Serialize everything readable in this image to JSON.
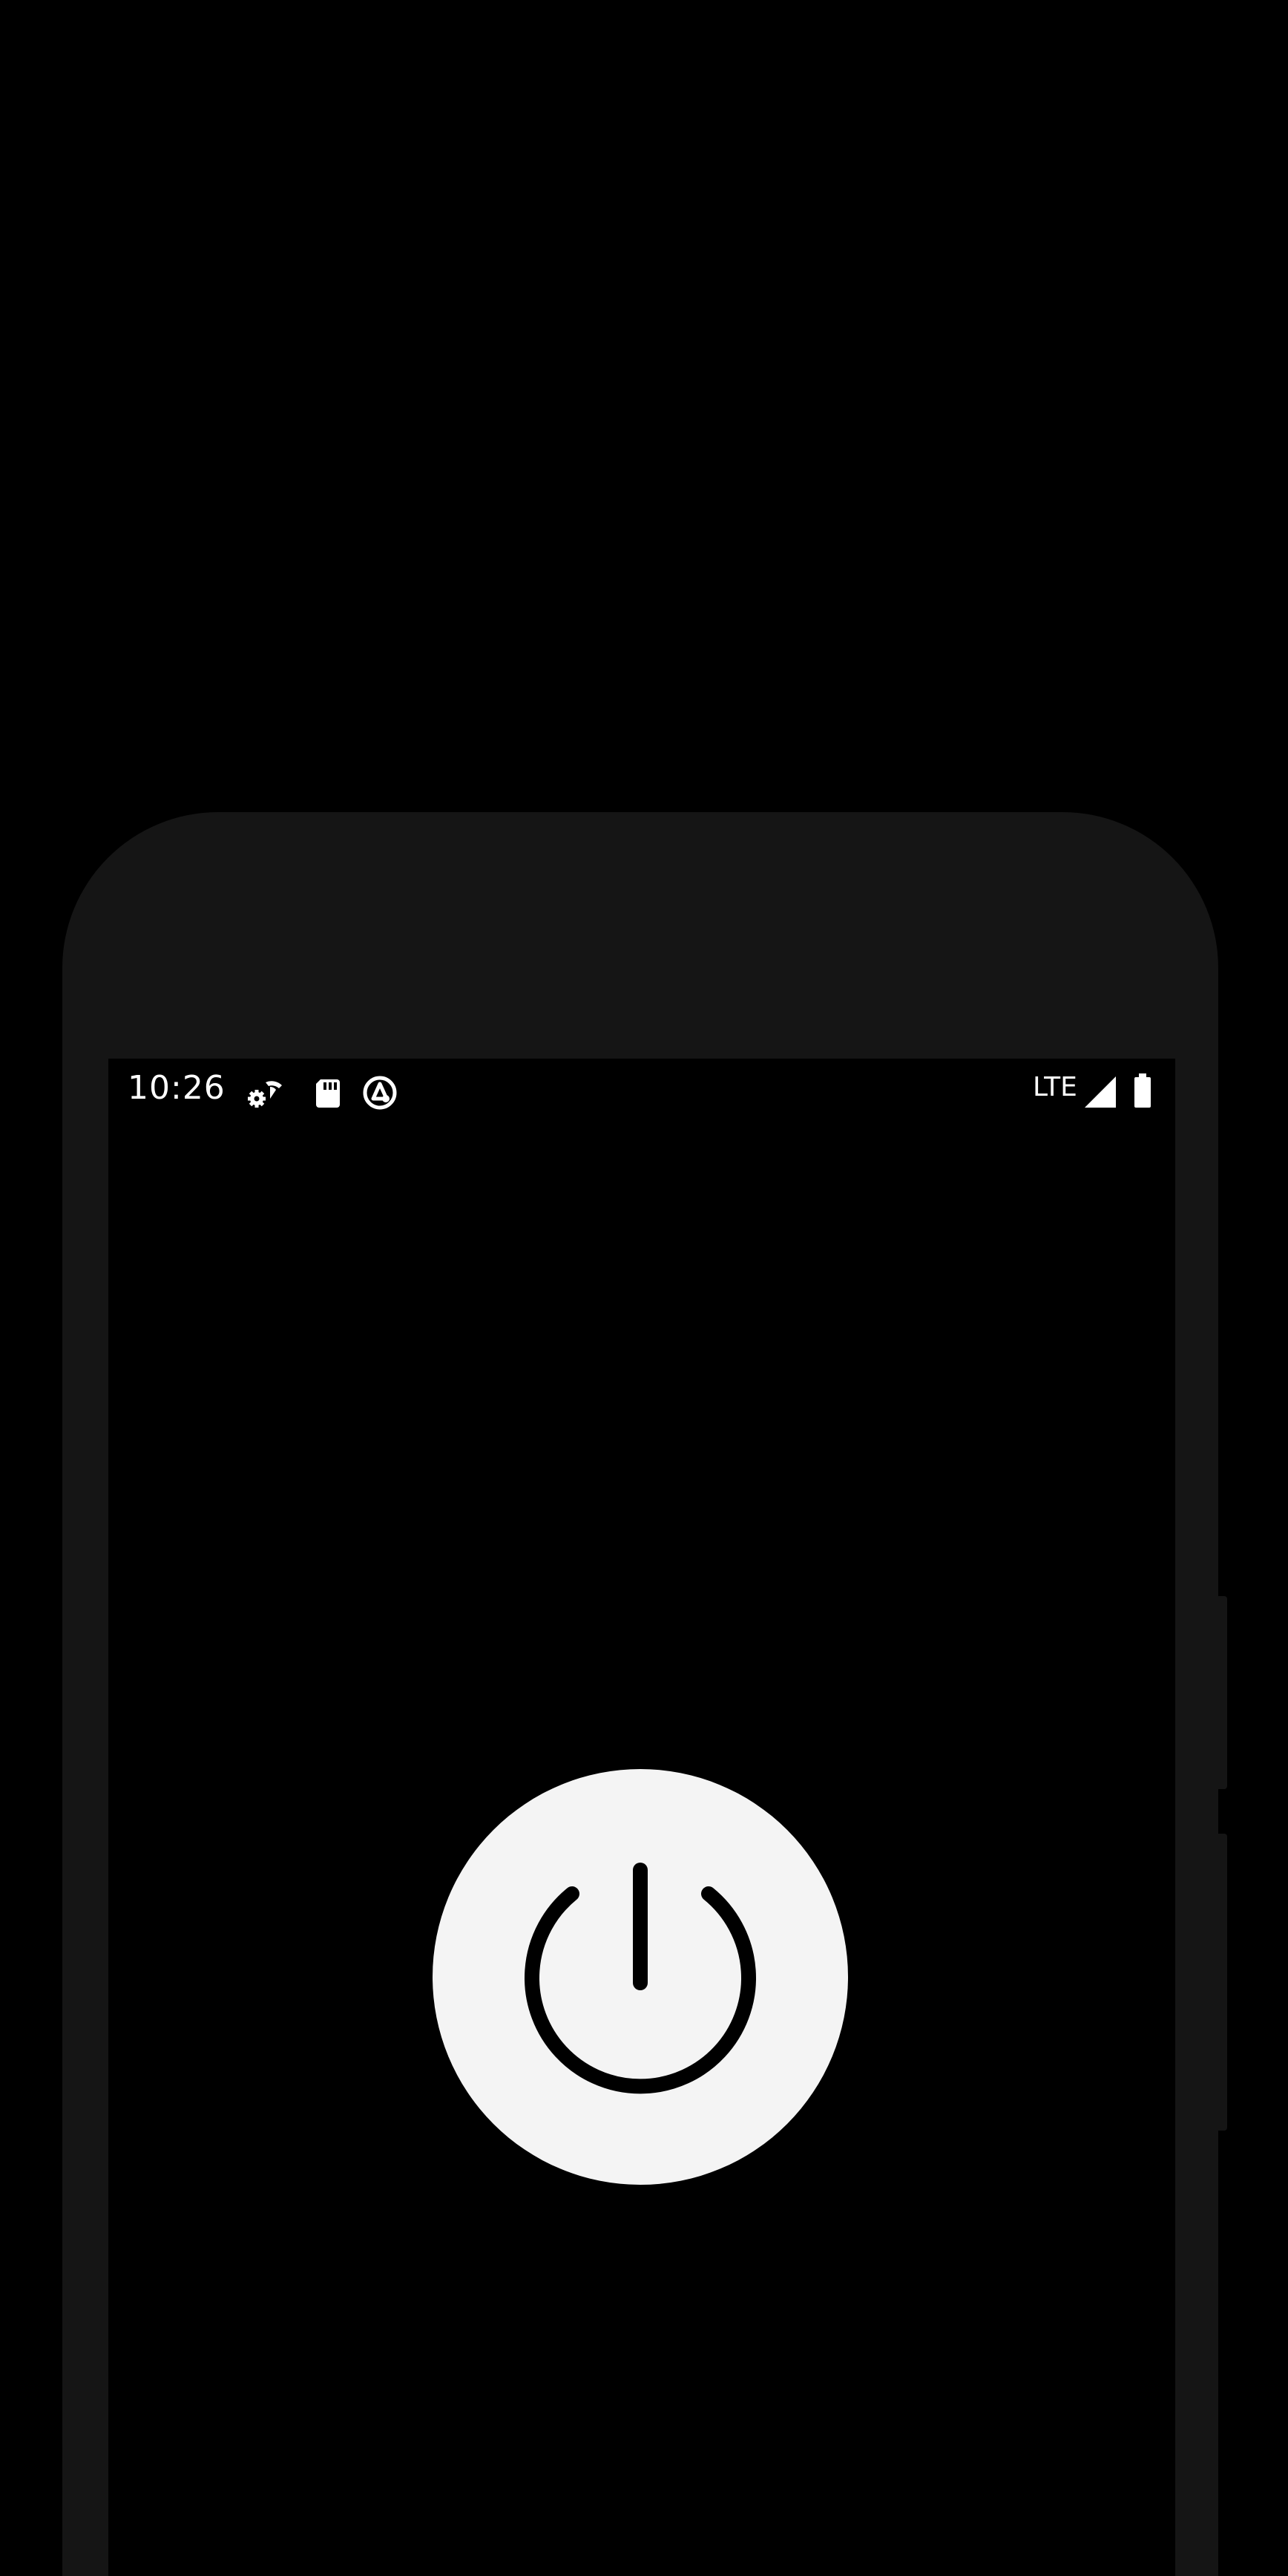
{
  "status_bar": {
    "time": "10:26",
    "network_label": "LTE",
    "left_icons": [
      "settings-wifi-icon",
      "sd-card-icon",
      "assistant-icon"
    ],
    "right_icons": [
      "signal-icon",
      "battery-icon"
    ]
  },
  "main": {
    "power_button": {
      "icon": "power-icon"
    }
  },
  "colors": {
    "background": "#000000",
    "phone_frame": "#151515",
    "button_fill": "#f4f4f4",
    "icon_stroke": "#000000",
    "status_text": "#ffffff"
  }
}
